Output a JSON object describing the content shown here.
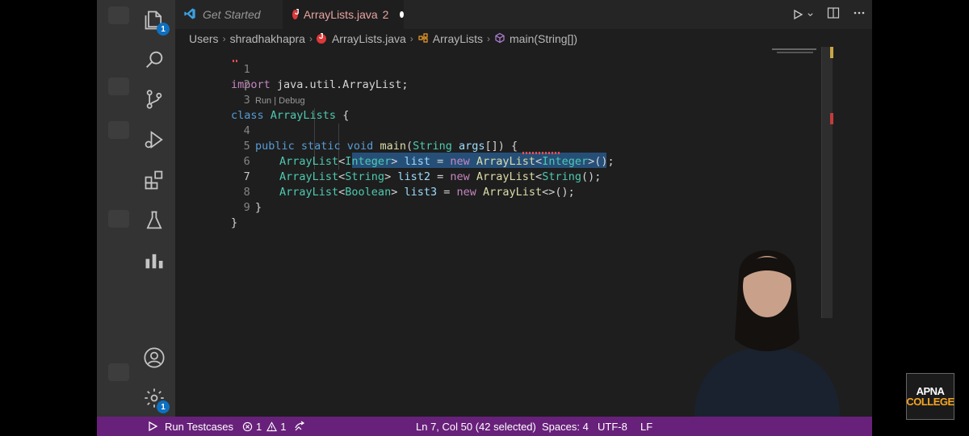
{
  "tabs": [
    {
      "label": "Get Started"
    },
    {
      "label": "ArrayLists.java",
      "problems": "2"
    }
  ],
  "breadcrumbs": [
    "Users",
    "shradhakhapra",
    "ArrayLists.java",
    "ArrayLists",
    "main(String[])"
  ],
  "badges": {
    "explorer": "1",
    "settings": "1"
  },
  "codelens": "Run | Debug",
  "line_numbers": [
    "1",
    "2",
    "3",
    "4",
    "5",
    "6",
    "7",
    "8",
    "9"
  ],
  "code": {
    "l1_kw": "import",
    "l1_rest": " java.util.ArrayList;",
    "l3_kw": "class",
    "l3_cls": "ArrayLists",
    "l3_rest": " {",
    "l4_mods": "public static void ",
    "l4_fn": "main",
    "l4_p1": "(",
    "l4_ty": "String",
    "l4_arg": " args",
    "l4_rest": "[]) {",
    "l5_a": "ArrayList",
    "l5_b": "<",
    "l5_c": "Integer",
    "l5_d": "> ",
    "l5_e": "list",
    "l5_f": " = ",
    "l5_g": "new ",
    "l5_h": "ArrayList",
    "l5_i": "<",
    "l5_j": "Integer",
    "l5_k": ">();",
    "l6_a": "ArrayList",
    "l6_b": "<",
    "l6_c": "String",
    "l6_d": "> ",
    "l6_e": "list2",
    "l6_f": " = ",
    "l6_g": "new ",
    "l6_h": "ArrayList",
    "l6_i": "<",
    "l6_j": "String",
    "l6_k": "();",
    "l7_a": "ArrayList",
    "l7_b": "<",
    "l7_c": "Boolean",
    "l7_d": "> ",
    "l7_e": "list3",
    "l7_f": " = ",
    "l7_g": "new ",
    "l7_h": "ArrayList",
    "l7_i": "<>();",
    "l8": "}",
    "l9": "}"
  },
  "status": {
    "run_testcases": "Run Testcases",
    "errors": "1",
    "warnings": "1",
    "position": "Ln 7, Col 50 (42 selected)",
    "spaces": "Spaces: 4",
    "encoding": "UTF-8",
    "eol": "LF"
  },
  "logo": {
    "line1": "APNA",
    "line2": "COLLEGE"
  },
  "colors": {
    "status_bar": "#68217a",
    "accent": "#0e70c0",
    "selection": "#264f78"
  }
}
